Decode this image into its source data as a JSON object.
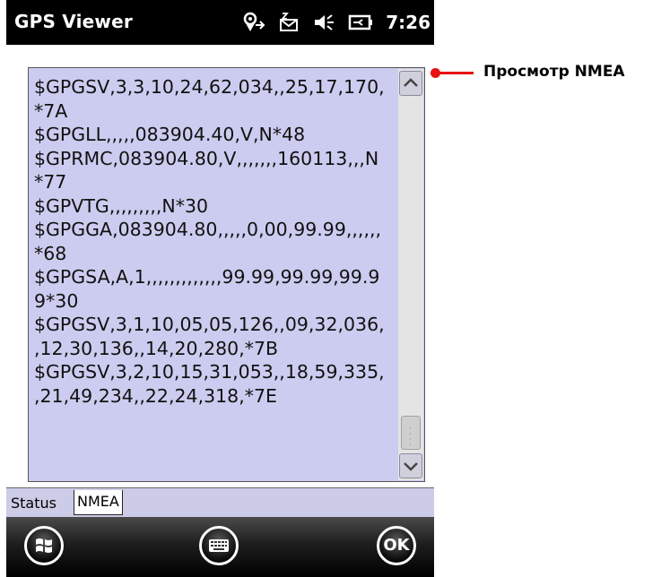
{
  "titlebar": {
    "title": "GPS Viewer",
    "clock": "7:26",
    "icons": [
      "gps-sync-icon",
      "mail-icon",
      "volume-icon",
      "battery-icon"
    ]
  },
  "nmea": {
    "text": "$GPGSV,3,3,10,24,62,034,,25,17,170,\n*7A\n$GPGLL,,,,,083904.40,V,N*48\n$GPRMC,083904.80,V,,,,,,,160113,,,N\n*77\n$GPVTG,,,,,,,,,N*30\n$GPGGA,083904.80,,,,,0,00,99.99,,,,,,\n*68\n$GPGSA,A,1,,,,,,,,,,,,,99.99,99.99,99.9\n9*30\n$GPGSV,3,1,10,05,05,126,,09,32,036,\n,12,30,136,,14,20,280,*7B\n$GPGSV,3,2,10,15,31,053,,18,59,335,\n,21,49,234,,22,24,318,*7E"
  },
  "tabs": [
    {
      "label": "Status",
      "selected": false
    },
    {
      "label": "NMEA",
      "selected": true
    }
  ],
  "softkeys": {
    "start_icon": "windows-icon",
    "keyboard_icon": "keyboard-icon",
    "ok_label": "OK"
  },
  "annotation": {
    "label": "Просмотр NMEA",
    "color": "#e81010"
  }
}
